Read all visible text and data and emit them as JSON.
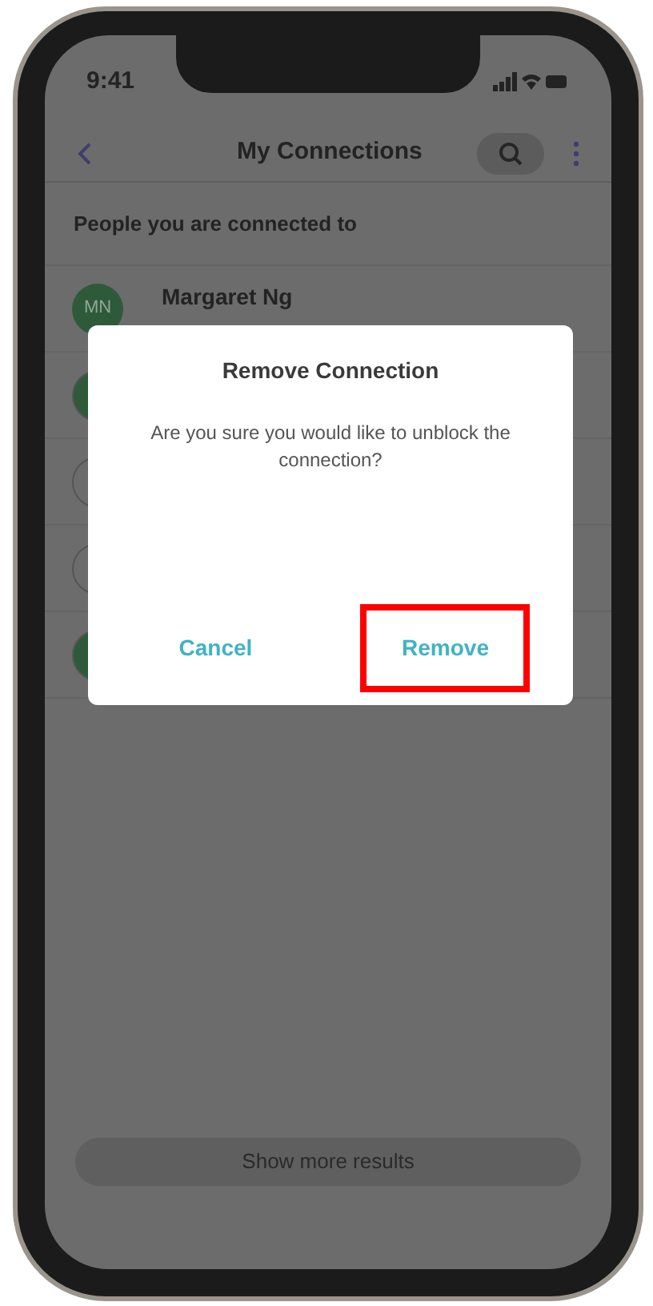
{
  "status_bar": {
    "time": "9:41"
  },
  "header": {
    "title": "My Connections"
  },
  "section_title": "People you are connected to",
  "connections": [
    {
      "name": "Margaret Ng",
      "initials": "MN"
    }
  ],
  "dialog": {
    "title": "Remove Connection",
    "message": "Are you sure you would like to unblock the connection?",
    "buttons": [
      {
        "label": "Cancel",
        "highlighted": false
      },
      {
        "label": "Remove",
        "highlighted": true
      }
    ]
  },
  "footer_button": "Show more results"
}
